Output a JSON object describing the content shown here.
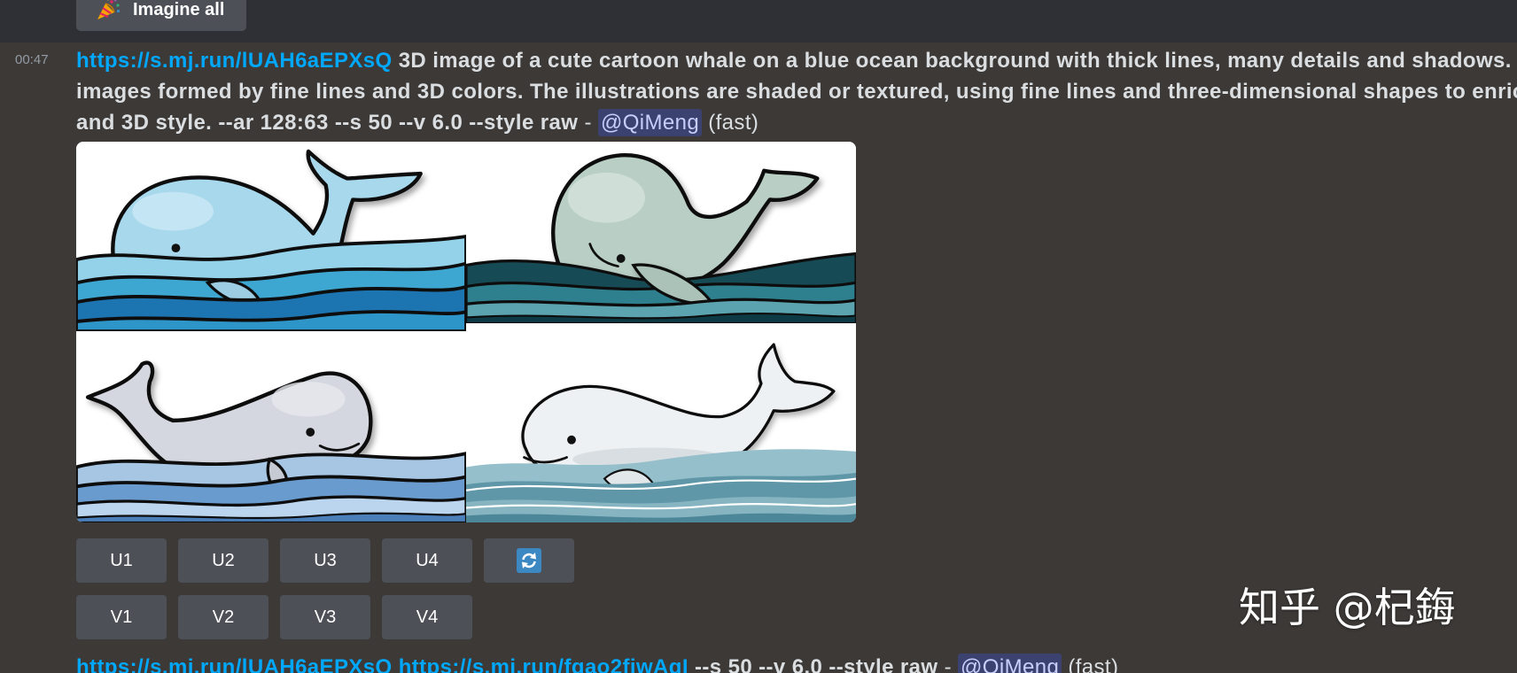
{
  "top_button": {
    "label": "Imagine all",
    "icon": "party-popper-icon"
  },
  "message": {
    "timestamp": "00:47",
    "link": "https://s.mj.run/lUAH6aEPXsQ",
    "lines": [
      "3D image of a cute cartoon whale on a blue ocean background with thick lines, many details and shadows. Rich a",
      "images formed by fine lines and 3D colors. The illustrations are shaded or textured, using fine lines and three-dimensional shapes to enrich the d",
      "and 3D style. --ar 128:63 --s 50 --v 6.0 --style raw"
    ],
    "separator": "-",
    "mention": "@QiMeng",
    "speed": "(fast)"
  },
  "upscale_buttons": [
    "U1",
    "U2",
    "U3",
    "U4"
  ],
  "reroll_button": {
    "icon": "refresh-icon"
  },
  "variation_buttons": [
    "V1",
    "V2",
    "V3",
    "V4"
  ],
  "next_message": {
    "links": [
      "https://s.mj.run/lUAH6aEPXsQ",
      "https://s.mj.run/fgao2fiwAgI"
    ],
    "params": "--s 50 --v 6.0 --style raw",
    "separator": "-",
    "mention": "@QiMeng",
    "speed": "(fast)"
  },
  "watermark": "知乎 @杞鋂",
  "colors": {
    "background": "#3c3937",
    "top_band": "#2f3035",
    "text": "#dbdee1",
    "link": "#00a8fc",
    "timestamp": "#949ba4",
    "mention_bg": "#3c4270",
    "mention_text": "#c9cdfb",
    "button_bg": "#4e5058",
    "reroll_icon": "#3b88c3",
    "watermark": "#ffffff"
  }
}
